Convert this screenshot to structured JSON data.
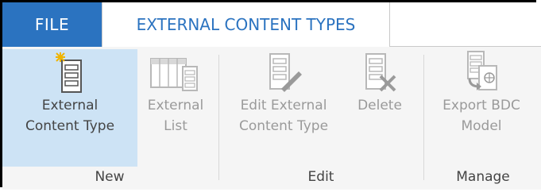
{
  "tabs": {
    "file": "FILE",
    "external_content_types": "EXTERNAL CONTENT TYPES"
  },
  "groups": {
    "new": {
      "label": "New",
      "external_content_type": {
        "line1": "External",
        "line2": "Content Type"
      },
      "external_list": {
        "line1": "External",
        "line2": "List"
      }
    },
    "edit": {
      "label": "Edit",
      "edit_external_content_type": {
        "line1": "Edit External",
        "line2": "Content Type"
      },
      "delete": {
        "line1": "Delete",
        "line2": ""
      }
    },
    "manage": {
      "label": "Manage",
      "export_bdc_model": {
        "line1": "Export BDC",
        "line2": "Model"
      }
    }
  },
  "colors": {
    "accent": "#2b73c0",
    "selected_bg": "#cde3f5",
    "ribbon_bg": "#f5f5f5"
  },
  "icons": [
    "new-content-type-icon",
    "external-list-icon",
    "edit-content-type-icon",
    "delete-icon",
    "export-model-icon"
  ]
}
